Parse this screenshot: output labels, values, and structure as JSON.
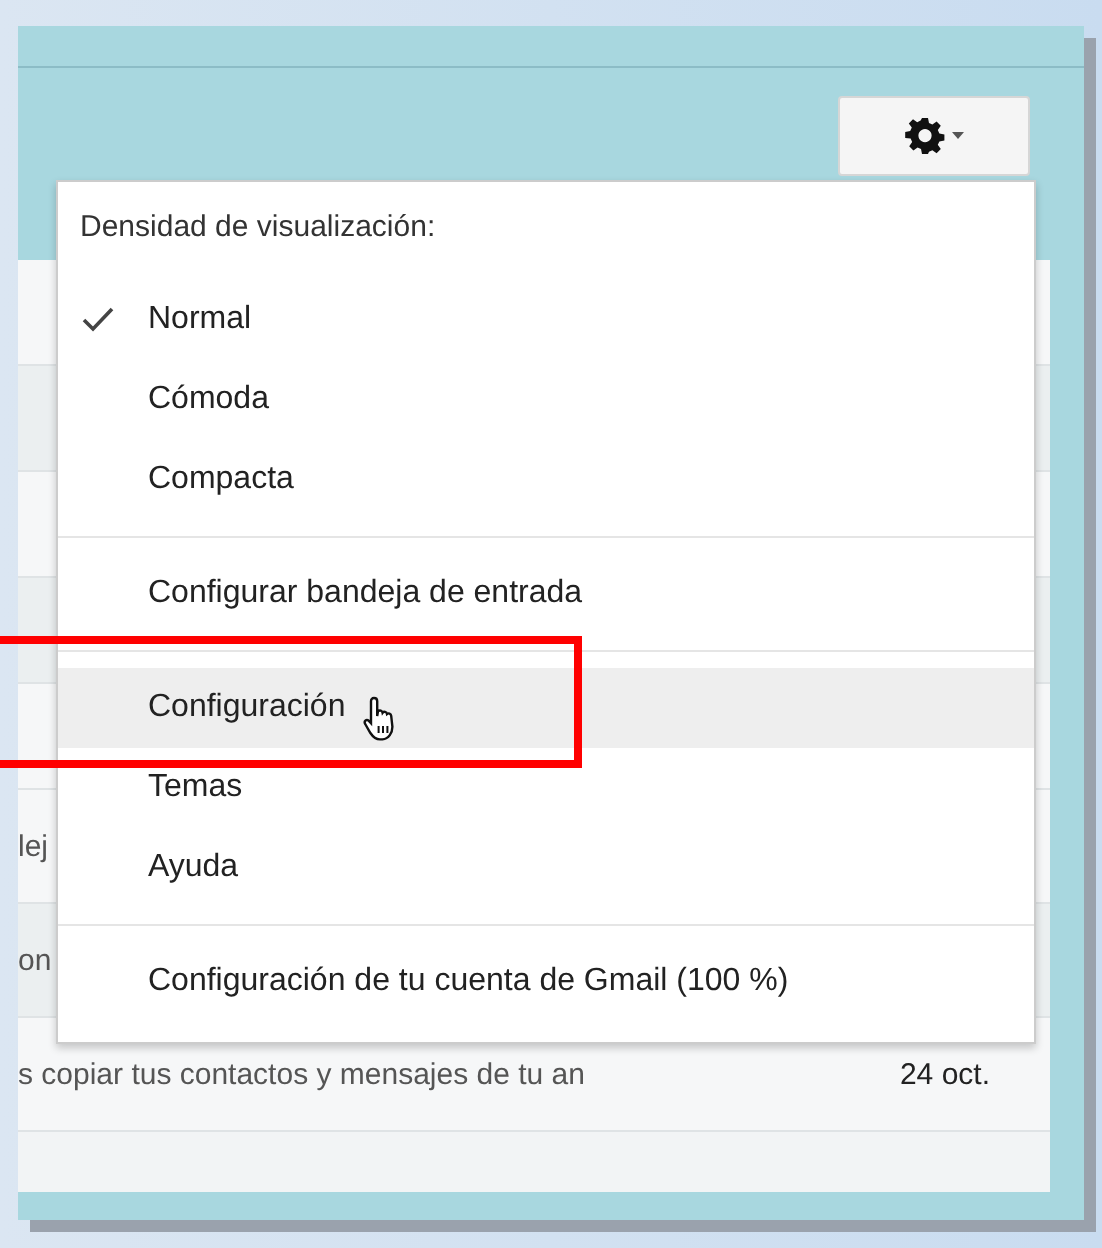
{
  "settings_menu": {
    "header": "Densidad de visualización:",
    "sections": [
      [
        {
          "label": "Normal",
          "checked": true,
          "selected": false
        },
        {
          "label": "Cómoda",
          "checked": false,
          "selected": false
        },
        {
          "label": "Compacta",
          "checked": false,
          "selected": false
        }
      ],
      [
        {
          "label": "Configurar bandeja de entrada",
          "checked": false,
          "selected": false
        }
      ],
      [
        {
          "label": "Configuración",
          "checked": false,
          "selected": true
        },
        {
          "label": "Temas",
          "checked": false,
          "selected": false
        },
        {
          "label": "Ayuda",
          "checked": false,
          "selected": false
        }
      ],
      [
        {
          "label": "Configuración de tu cuenta de Gmail (100 %)",
          "checked": false,
          "selected": false
        }
      ]
    ]
  },
  "email_rows": [
    {
      "snippet": "lej"
    },
    {
      "snippet": "on"
    },
    {
      "snippet": "s copiar tus contactos y mensajes de tu an",
      "date": "24 oct."
    }
  ]
}
